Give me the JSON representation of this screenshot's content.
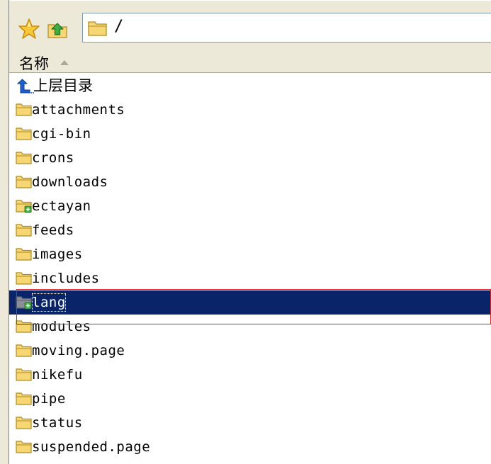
{
  "address": {
    "path": "/"
  },
  "toolbar": {
    "favorites_icon": "star-icon",
    "up_icon": "up-folder-icon",
    "address_folder_icon": "folder-icon"
  },
  "header": {
    "name_column": "名称",
    "sort_direction": "ascending"
  },
  "items": [
    {
      "label": "上层目录",
      "icon": "parent-directory-icon",
      "type": "parent"
    },
    {
      "label": "attachments",
      "icon": "folder-icon",
      "type": "folder"
    },
    {
      "label": "cgi-bin",
      "icon": "folder-icon",
      "type": "folder"
    },
    {
      "label": "crons",
      "icon": "folder-icon",
      "type": "folder"
    },
    {
      "label": "downloads",
      "icon": "folder-icon",
      "type": "folder"
    },
    {
      "label": "ectayan",
      "icon": "new-folder-icon",
      "type": "folder-new"
    },
    {
      "label": "feeds",
      "icon": "folder-icon",
      "type": "folder"
    },
    {
      "label": "images",
      "icon": "folder-icon",
      "type": "folder"
    },
    {
      "label": "includes",
      "icon": "folder-icon",
      "type": "folder"
    },
    {
      "label": "lang",
      "icon": "new-folder-icon",
      "type": "folder-new",
      "selected": true
    },
    {
      "label": "modules",
      "icon": "folder-icon",
      "type": "folder"
    },
    {
      "label": "moving.page",
      "icon": "folder-icon",
      "type": "folder"
    },
    {
      "label": "nikefu",
      "icon": "folder-icon",
      "type": "folder"
    },
    {
      "label": "pipe",
      "icon": "folder-icon",
      "type": "folder"
    },
    {
      "label": "status",
      "icon": "folder-icon",
      "type": "folder"
    },
    {
      "label": "suspended.page",
      "icon": "folder-icon",
      "type": "folder"
    }
  ],
  "colors": {
    "selection_background": "#0a246a",
    "selection_text": "#ffffff",
    "annotation_box": "#e02020",
    "folder_fill": "#f7d774",
    "folder_outline": "#b08a20"
  }
}
